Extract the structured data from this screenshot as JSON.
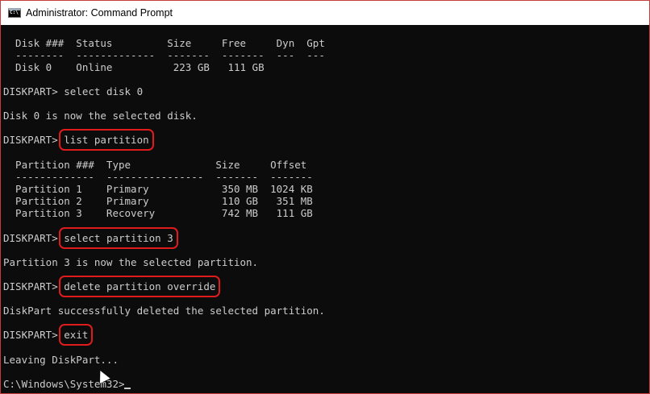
{
  "window": {
    "title": "Administrator: Command Prompt",
    "icon": "cmd-app-icon"
  },
  "console": {
    "disk_header": "  Disk ###  Status         Size     Free     Dyn  Gpt",
    "disk_rule": "  --------  -------------  -------  -------  ---  ---",
    "disk_row": "  Disk 0    Online          223 GB   111 GB",
    "prompt": "DISKPART> ",
    "cmd_select_disk": "select disk 0",
    "msg_disk_selected": "Disk 0 is now the selected disk.",
    "cmd_list_partition": "list partition",
    "part_header": "  Partition ###  Type              Size     Offset",
    "part_rule": "  -------------  ----------------  -------  -------",
    "part_rows": [
      "  Partition 1    Primary            350 MB  1024 KB",
      "  Partition 2    Primary            110 GB   351 MB",
      "  Partition 3    Recovery           742 MB   111 GB"
    ],
    "cmd_select_partition": "select partition 3",
    "msg_partition_selected": "Partition 3 is now the selected partition.",
    "cmd_delete_partition": "delete partition override",
    "msg_deleted": "DiskPart successfully deleted the selected partition.",
    "cmd_exit": "exit",
    "msg_leaving": "Leaving DiskPart...",
    "final_prompt": "C:\\Windows\\System32>"
  },
  "colors": {
    "console_bg": "#0c0c0c",
    "console_text": "#cccccc",
    "highlight": "#e01b1b"
  }
}
